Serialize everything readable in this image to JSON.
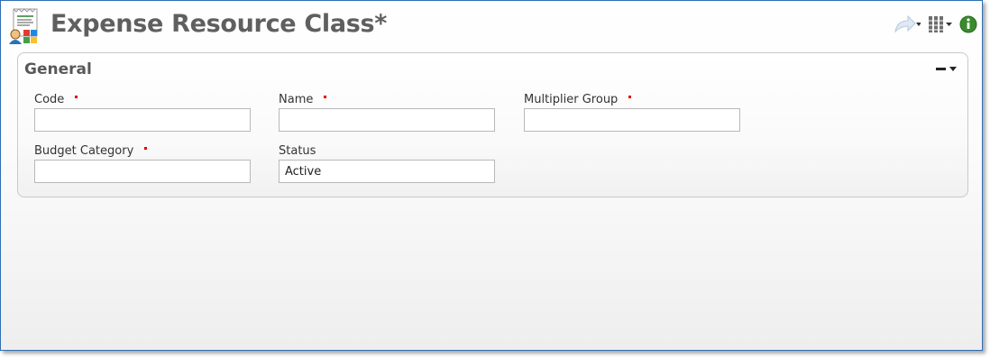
{
  "header": {
    "title": "Expense Resource Class*",
    "app_icon": "expense-report-icon",
    "tools": [
      "share-icon",
      "columns-menu-icon",
      "info-icon"
    ],
    "info_color": "#3a8a2e"
  },
  "section": {
    "title": "General",
    "collapse_icon": "collapse-icon"
  },
  "fields": {
    "code": {
      "label": "Code",
      "value": "",
      "required": true
    },
    "name": {
      "label": "Name",
      "value": "",
      "required": true
    },
    "multiplier_group": {
      "label": "Multiplier Group",
      "value": "",
      "required": true
    },
    "budget_category": {
      "label": "Budget Category",
      "value": "",
      "required": true
    },
    "status": {
      "label": "Status",
      "value": "Active",
      "required": false
    }
  },
  "colors": {
    "border": "#2f6fb3",
    "required_marker": "#e00000",
    "title_text": "#5f5f5f"
  }
}
